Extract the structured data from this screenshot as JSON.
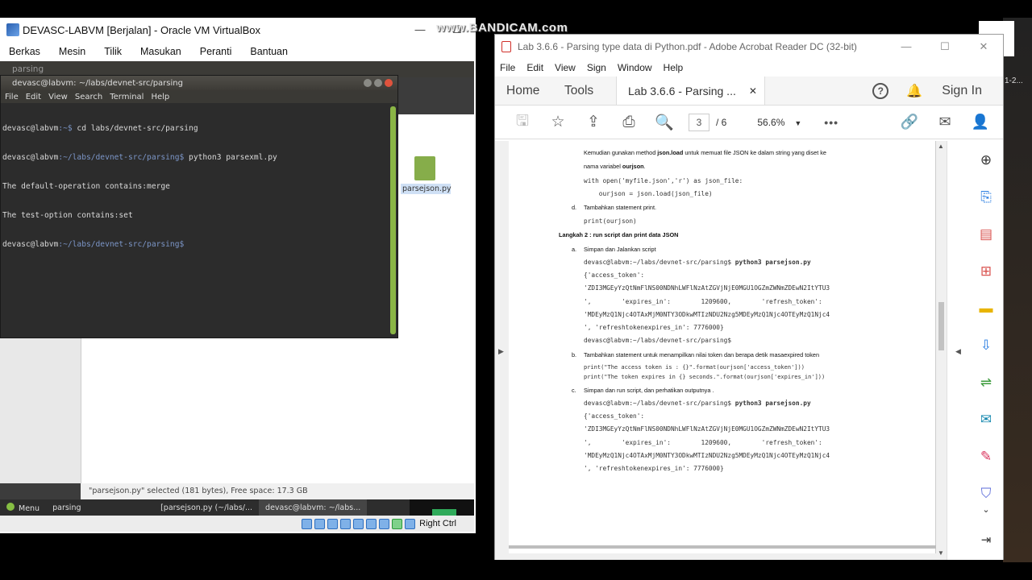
{
  "vbox": {
    "title": "DEVASC-LABVM [Berjalan] - Oracle VM VirtualBox",
    "min": "—",
    "max": "☐",
    "menu": [
      "Berkas",
      "Mesin",
      "Tilik",
      "Masukan",
      "Peranti",
      "Bantuan"
    ],
    "right_ctrl": "Right Ctrl"
  },
  "guest": {
    "fm_header": "parsing",
    "file_name": "parsejson.py",
    "status": "\"parsejson.py\" selected (181 bytes), Free space: 17.3 GB",
    "taskbar": [
      "Menu",
      "parsing",
      "[parsejson.py (~/labs/...",
      "devasc@labvm: ~/labs..."
    ]
  },
  "terminal": {
    "title": "devasc@labvm: ~/labs/devnet-src/parsing",
    "menu": [
      "File",
      "Edit",
      "View",
      "Search",
      "Terminal",
      "Help"
    ],
    "lines": [
      {
        "user": "devasc@labvm",
        "path": ":~$",
        "cmd": " cd labs/devnet-src/parsing"
      },
      {
        "user": "devasc@labvm",
        "path": ":~/labs/devnet-src/parsing$",
        "cmd": " python3 parsexml.py"
      },
      {
        "out": "The default-operation contains:merge"
      },
      {
        "out": "The test-option contains:set"
      },
      {
        "user": "devasc@labvm",
        "path": ":~/labs/devnet-src/parsing$",
        "cmd": ""
      }
    ]
  },
  "watermark": "www.BANDICAM.com",
  "acrobat": {
    "title": "Lab 3.6.6 - Parsing type data di Python.pdf - Adobe Acrobat Reader DC (32-bit)",
    "menu": [
      "File",
      "Edit",
      "View",
      "Sign",
      "Window",
      "Help"
    ],
    "nav_home": "Home",
    "nav_tools": "Tools",
    "tab_label": "Lab 3.6.6 - Parsing ...",
    "sign_in": "Sign In",
    "page_current": "3",
    "page_total": "/ 6",
    "zoom": "56.6%",
    "doc": {
      "l1": "Kemudian gunakan method ",
      "l1b": "json.load",
      "l1c": " untuk memuat file JSON ke dalam string yang diset ke",
      "l2": "nama variabel ",
      "l2b": "ourjson",
      "l2c": ".",
      "code1": "with open('myfile.json','r') as json_file:",
      "code2": "    ourjson = json.load(json_file)",
      "d": "d.",
      "d_text": "Tambahkan statement print.",
      "code3": "print(ourjson)",
      "step2": "Langkah 2 : run script dan print data JSON",
      "a": "a.",
      "a_text": "Simpan dan Jalankan script",
      "cmd": "devasc@labvm:~/labs/devnet-src/parsing$ ",
      "cmd_b": "python3 parsejson.py",
      "o1": "{'access_token':",
      "o2": "'ZDI3MGEyYzQtNmFlNS00NDNhLWFlNzAtZGVjNjE0MGU1OGZmZWNmZDEwN2ItYTU3",
      "o3": "',        'expires_in':        1209600,        'refresh_token':",
      "o4": "'MDEyMzQ1Njc4OTAxMjM0NTY3ODkwMTIzNDU2Nzg5MDEyMzQ1Njc4OTEyMzQ1Njc4",
      "o5": "', 'refreshtokenexpires_in': 7776000}",
      "prompt": "devasc@labvm:~/labs/devnet-src/parsing$",
      "b": "b.",
      "b_text": "Tambahkan statement untuk menampilkan nilai token dan berapa detik masaexpired token",
      "pr1": "print(\"The access token is : {}\".format(ourjson['access_token']))",
      "pr2": "print(\"The token expires in {} seconds.\".format(ourjson['expires_in']))",
      "c": "c.",
      "c_text": "Simpan dan run script, dan perhatikan outputnya ."
    }
  },
  "desktop": {
    "side_text": "1-2..."
  }
}
